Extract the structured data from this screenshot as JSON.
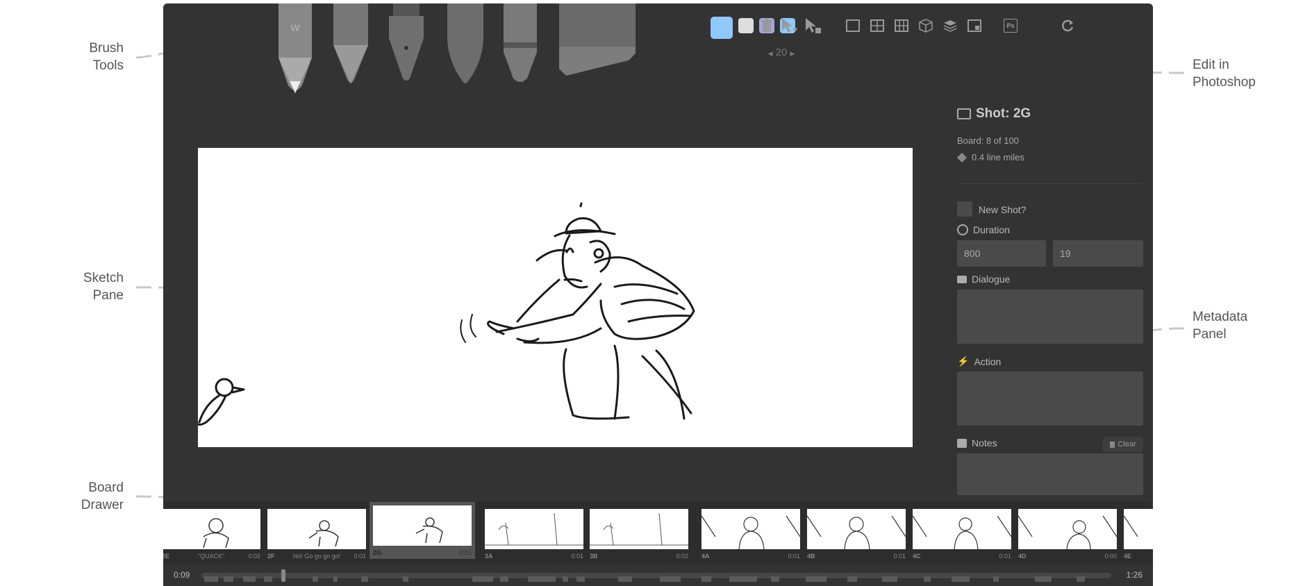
{
  "annotations": {
    "brush_tools": "Brush\nTools",
    "sketch_pane": "Sketch\nPane",
    "board_drawer": "Board\nDrawer",
    "edit_in_photoshop": "Edit in\nPhotoshop",
    "metadata_panel": "Metadata\nPanel"
  },
  "toolbar": {
    "brushes": [
      "light-pencil-icon",
      "pencil-icon",
      "pen-icon",
      "brush-icon",
      "note-pen-icon",
      "eraser-icon"
    ],
    "colors": [
      "#8ec8ff",
      "#dddddd",
      "#a3a8e0",
      "#8ec8ff"
    ],
    "brush_size": "20",
    "tools": [
      "trash-icon",
      "move-icon",
      "copy-move-icon"
    ],
    "grid_tools": [
      "single-grid-icon",
      "four-grid-icon",
      "six-grid-icon",
      "cube-icon",
      "layers-icon",
      "onion-skin-icon"
    ],
    "photoshop_label": "Ps",
    "refresh_icon": "refresh-icon"
  },
  "metadata": {
    "shot_title": "Shot: 2G",
    "board_position": "Board: 8 of 100",
    "line_miles": "0.4 line miles",
    "new_shot_label": "New Shot?",
    "duration_label": "Duration",
    "duration_ms": "800",
    "duration_frames": "19",
    "dialogue_label": "Dialogue",
    "dialogue_value": "",
    "action_label": "Action",
    "action_value": "",
    "notes_label": "Notes",
    "notes_value": "",
    "clear_label": "Clear"
  },
  "boards": [
    {
      "name": "2E",
      "dialogue": "\"QUACK\"",
      "time": "0:02"
    },
    {
      "name": "2F",
      "dialogue": "No! Go go go go!",
      "time": "0:01"
    },
    {
      "name": "2G",
      "dialogue": "",
      "time": "0:01",
      "current": true
    },
    {
      "name": "3A",
      "dialogue": "",
      "time": "0:01"
    },
    {
      "name": "3B",
      "dialogue": "",
      "time": "0:02"
    },
    {
      "name": "4A",
      "dialogue": "",
      "time": "0:01"
    },
    {
      "name": "4B",
      "dialogue": "",
      "time": "0:01"
    },
    {
      "name": "4C",
      "dialogue": "",
      "time": "0:01"
    },
    {
      "name": "4D",
      "dialogue": "",
      "time": "0:00"
    },
    {
      "name": "4E",
      "dialogue": "",
      "time": ""
    }
  ],
  "timeline": {
    "current_time": "0:09",
    "total_time": "1:26",
    "position_fraction": 0.09
  }
}
